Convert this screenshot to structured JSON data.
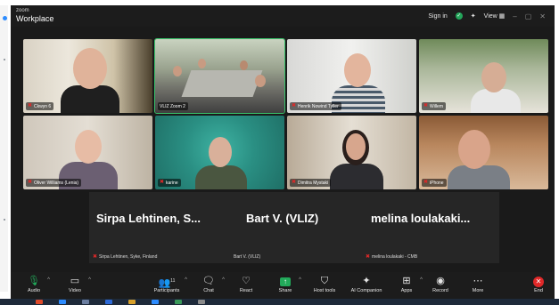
{
  "app": {
    "brand_small": "zoom",
    "brand_title": "Workplace"
  },
  "titlebar": {
    "sign_in": "Sign in",
    "view": "View",
    "view_icon": "grid-icon",
    "minimize": "–",
    "maximize": "▢",
    "close": "✕"
  },
  "participants": [
    {
      "name": "Ckwyn 6"
    },
    {
      "name": "VLIZ Zoom 2"
    },
    {
      "name": "Henrik Nowind Tyller"
    },
    {
      "name": "Willem"
    },
    {
      "name": "Oliver Williams (Lenia)"
    },
    {
      "name": "karine"
    },
    {
      "name": "Dimitra Mystaki"
    },
    {
      "name": "iPhone"
    }
  ],
  "name_tiles": [
    {
      "display": "Sirpa Lehtinen, S...",
      "label": "Sirpa Lehtinen, Syke, Finland"
    },
    {
      "display": "Bart V. (VLIZ)",
      "label": "Bart V. (VLIZ)"
    },
    {
      "display": "melina loulakaki...",
      "label": "melina loulakaki - CMB"
    }
  ],
  "toolbar": {
    "audio": "Audio",
    "video": "Video",
    "participants": "Participants",
    "participant_count": "11",
    "chat": "Chat",
    "react": "React",
    "share": "Share",
    "host_tools": "Host tools",
    "ai_companion": "AI Companion",
    "apps": "Apps",
    "record": "Record",
    "more": "More",
    "end": "End"
  },
  "colors": {
    "accent_green": "#22a95a",
    "end_red": "#e02828",
    "window_bg": "#1a1a1a"
  }
}
